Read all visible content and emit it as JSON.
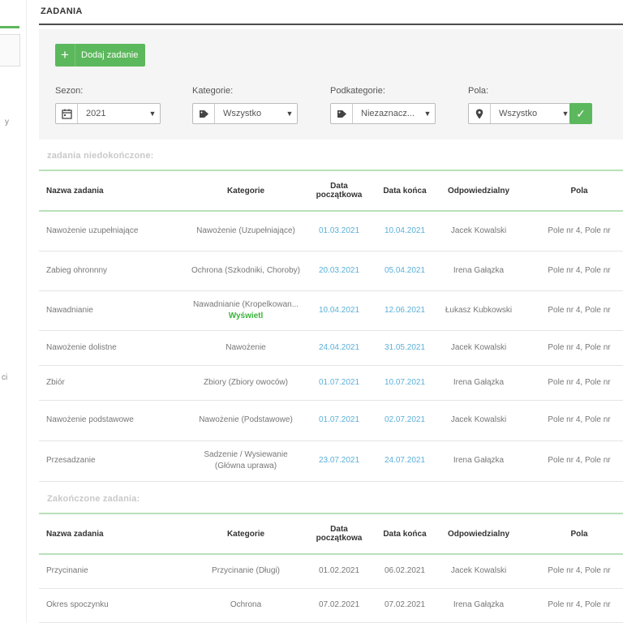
{
  "page": {
    "title": "ZADANIA"
  },
  "sidebar": {
    "frag1": "y",
    "frag2": "ci"
  },
  "toolbar": {
    "add_label": "Dodaj zadanie",
    "filters": [
      {
        "label": "Sezon:",
        "value": "2021",
        "icon": "calendar-icon"
      },
      {
        "label": "Kategorie:",
        "value": "Wszystko",
        "icon": "tag-icon"
      },
      {
        "label": "Podkategorie:",
        "value": "Niezaznacz...",
        "icon": "tag-icon"
      },
      {
        "label": "Pola:",
        "value": "Wszystko",
        "icon": "map-marker-icon"
      }
    ],
    "ok_icon": "checkmark-icon",
    "accent": "#5cb85c"
  },
  "columns": {
    "name": "Nazwa zadania",
    "category": "Kategorie",
    "start": "Data początkowa",
    "end": "Data końca",
    "owner": "Odpowiedzialny",
    "fields": "Pola"
  },
  "open_tasks": {
    "title": "zadania niedokończone:",
    "rows": [
      {
        "name": "Nawożenie uzupełniające",
        "category": "Nawożenie (Uzupełniające)",
        "start": "01.03.2021",
        "end": "10.04.2021",
        "owner": "Jacek Kowalski",
        "fields": "Pole nr 4, Pole nr"
      },
      {
        "name": "Zabieg ohronnny",
        "category": "Ochrona (Szkodniki, Choroby)",
        "start": "20.03.2021",
        "end": "05.04.2021",
        "owner": "Irena Gałązka",
        "fields": "Pole nr 4, Pole nr"
      },
      {
        "name": "Nawadnianie",
        "category": "Nawadnianie (Kropelkowan...",
        "more": "Wyświetl",
        "start": "10.04.2021",
        "end": "12.06.2021",
        "owner": "Łukasz Kubkowski",
        "fields": "Pole nr 4, Pole nr"
      },
      {
        "name": "Nawożenie dolistne",
        "category": "Nawożenie",
        "start": "24.04.2021",
        "end": "31.05.2021",
        "owner": "Jacek Kowalski",
        "fields": "Pole nr 4, Pole nr"
      },
      {
        "name": "Zbiór",
        "category": "Zbiory (Zbiory owoców)",
        "start": "01.07.2021",
        "end": "10.07.2021",
        "owner": "Irena Gałązka",
        "fields": "Pole nr 4, Pole nr"
      },
      {
        "name": "Nawożenie podstawowe",
        "category": "Nawożenie (Podstawowe)",
        "start": "01.07.2021",
        "end": "02.07.2021",
        "owner": "Jacek Kowalski",
        "fields": "Pole nr 4, Pole nr"
      },
      {
        "name": "Przesadzanie",
        "category": "Sadzenie / Wysiewanie (Główna uprawa)",
        "start": "23.07.2021",
        "end": "24.07.2021",
        "owner": "Irena Gałązka",
        "fields": "Pole nr 4, Pole nr"
      }
    ]
  },
  "done_tasks": {
    "title": "Zakończone zadania:",
    "rows": [
      {
        "name": "Przycinanie",
        "category": "Przycinanie (Długi)",
        "start": "01.02.2021",
        "end": "06.02.2021",
        "owner": "Jacek Kowalski",
        "fields": "Pole nr 4, Pole nr"
      },
      {
        "name": "Okres spoczynku",
        "category": "Ochrona",
        "start": "07.02.2021",
        "end": "07.02.2021",
        "owner": "Irena Gałązka",
        "fields": "Pole nr 4, Pole nr"
      }
    ]
  }
}
